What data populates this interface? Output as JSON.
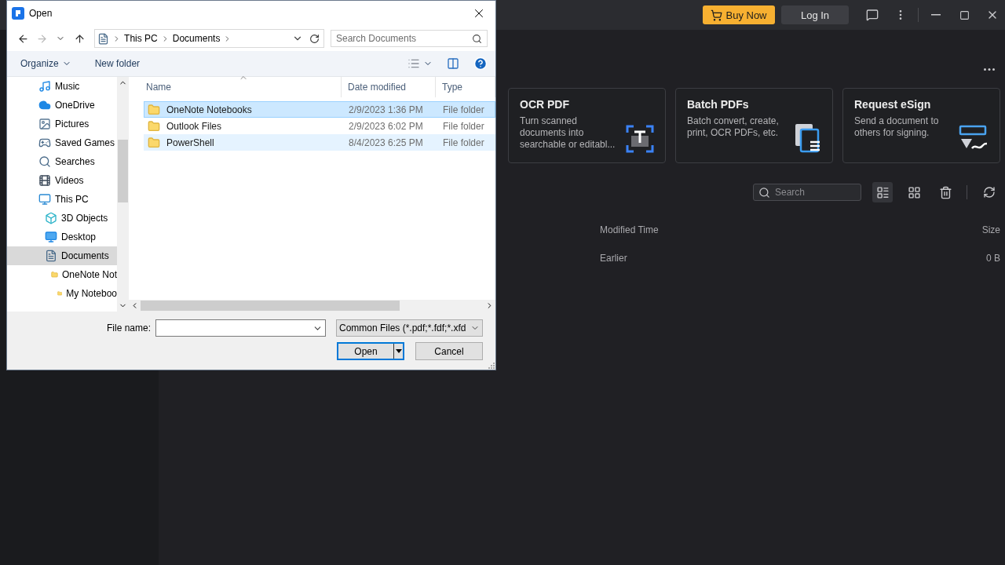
{
  "app": {
    "topbar": {
      "buy_button": "Buy Now",
      "login_button": "Log In"
    },
    "cards": [
      {
        "kind": "ocr",
        "title": "OCR PDF",
        "description": "Turn scanned documents into searchable or editabl..."
      },
      {
        "kind": "batch",
        "title": "Batch PDFs",
        "description": "Batch convert, create, print, OCR PDFs, etc."
      },
      {
        "kind": "esign",
        "title": "Request eSign",
        "description": "Send a document to others for signing."
      }
    ],
    "search": {
      "placeholder": "Search"
    },
    "view_buttons": [
      {
        "kind": "list",
        "selected": true
      },
      {
        "kind": "grid",
        "selected": false
      },
      {
        "kind": "clean",
        "selected": false
      }
    ],
    "table": {
      "columns": [
        "Modified Time",
        "Size"
      ],
      "rows": [
        [
          "Earlier",
          "0 B"
        ]
      ]
    }
  },
  "dialog": {
    "title": "Open",
    "breadcrumb": [
      "This PC",
      "Documents"
    ],
    "search": {
      "placeholder": "Search Documents"
    },
    "commands": {
      "organize": "Organize",
      "new_folder": "New folder"
    },
    "nav_tree": [
      {
        "label": "Music",
        "kind": "music",
        "selected": false
      },
      {
        "label": "OneDrive",
        "kind": "cloud",
        "selected": false
      },
      {
        "label": "Pictures",
        "kind": "pictures",
        "selected": false
      },
      {
        "label": "Saved Games",
        "kind": "games",
        "selected": false
      },
      {
        "label": "Searches",
        "kind": "search",
        "selected": false
      },
      {
        "label": "Videos",
        "kind": "videos",
        "selected": false
      },
      {
        "label": "This PC",
        "kind": "pc",
        "selected": false,
        "children": [
          {
            "label": "3D Objects",
            "kind": "cube",
            "selected": false
          },
          {
            "label": "Desktop",
            "kind": "desktop",
            "selected": false
          },
          {
            "label": "Documents",
            "kind": "documents",
            "selected": true,
            "children": [
              {
                "label": "OneNote Not",
                "kind": "folder",
                "selected": false,
                "children": [
                  {
                    "label": "My Noteboo",
                    "kind": "folder",
                    "selected": false
                  }
                ]
              }
            ]
          }
        ]
      }
    ],
    "columns": [
      "Name",
      "Date modified",
      "Type"
    ],
    "files": [
      {
        "name": "OneNote Notebooks",
        "date": "2/9/2023 1:36 PM",
        "type": "File folder",
        "selected": true,
        "hovered": false
      },
      {
        "name": "Outlook Files",
        "date": "2/9/2023 6:02 PM",
        "type": "File folder",
        "selected": false,
        "hovered": false
      },
      {
        "name": "PowerShell",
        "date": "8/4/2023 6:25 PM",
        "type": "File folder",
        "selected": false,
        "hovered": true
      }
    ],
    "file_name_label": "File name:",
    "filter": "Common Files (*.pdf;*.fdf;*.xfd",
    "buttons": {
      "open": "Open",
      "cancel": "Cancel"
    }
  }
}
